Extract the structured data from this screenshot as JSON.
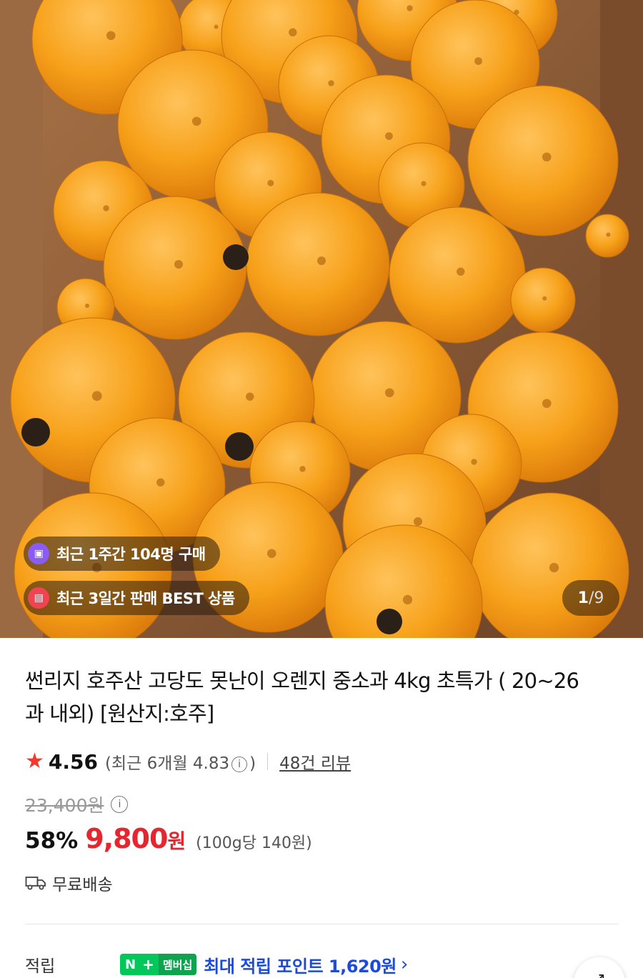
{
  "hero": {
    "badges": [
      {
        "icon": "shopping-bag-icon",
        "text": "최근 1주간 104명 구매"
      },
      {
        "icon": "gift-icon",
        "text": "최근 3일간 판매 BEST 상품"
      }
    ],
    "counter": {
      "current": "1",
      "separator": "/",
      "total": "9"
    }
  },
  "product": {
    "title": "썬리지 호주산 고당도 못난이 오렌지 중소과 4kg 초특가 ( 20~26과 내외) [원산지:호주]",
    "rating": "4.56",
    "recent_rating_prefix": "(최근 6개월 4.83",
    "recent_rating_suffix": ")",
    "reviews": "48건 리뷰",
    "original_price": "23,400원",
    "discount": "58%",
    "price": "9,800",
    "currency": "원",
    "unit_price": "(100g당 140원)",
    "shipping": "무료배송",
    "points_label": "적립",
    "membership_n": "N",
    "membership_plus": "+",
    "membership_label": "멤버십",
    "points_text": "최대 적립 포인트 1,620원"
  },
  "colors": {
    "accent_red": "#e5262e",
    "points_blue": "#1e4ad9",
    "naver_green": "#03c75a",
    "star": "#f03a2e"
  }
}
